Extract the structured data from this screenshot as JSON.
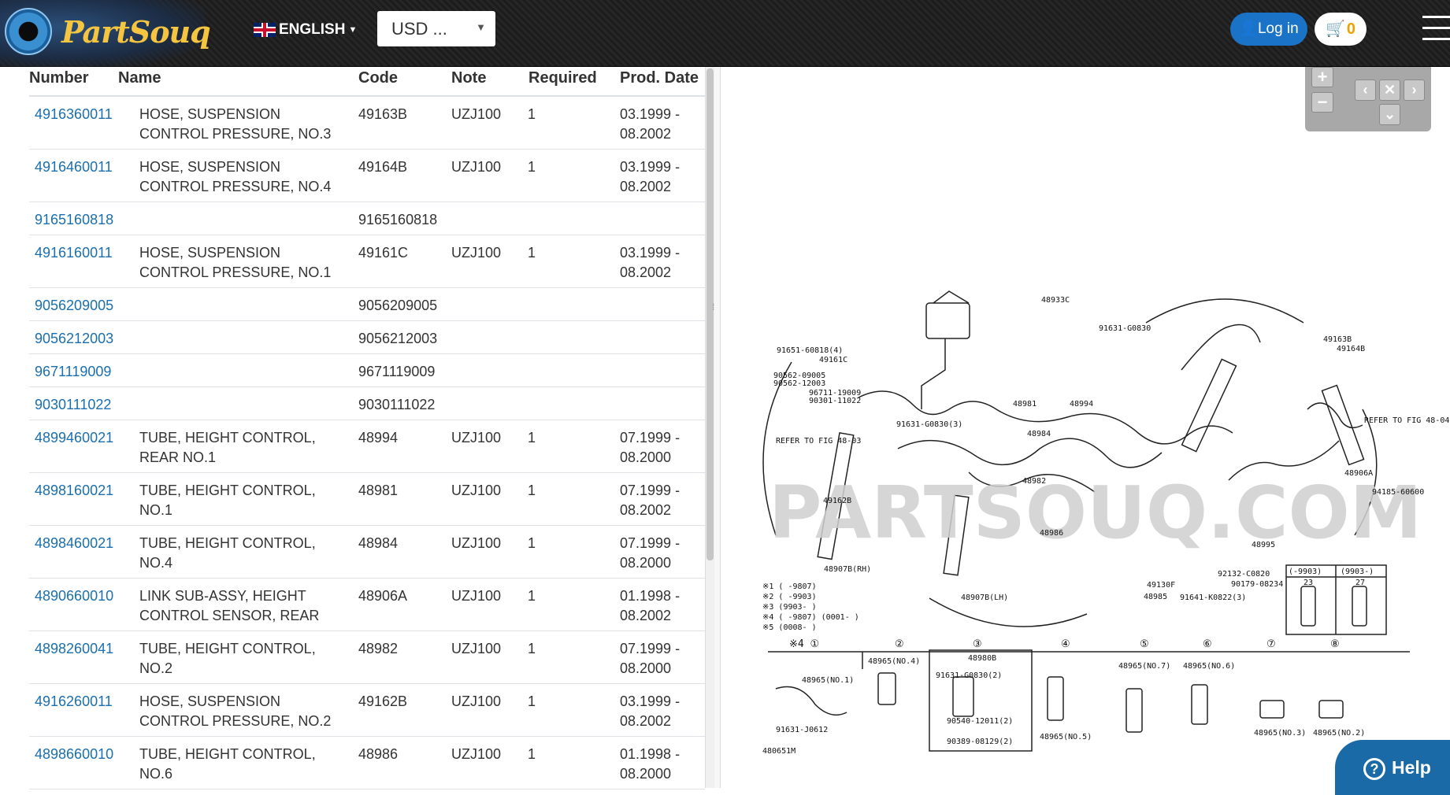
{
  "header": {
    "logo_text": "PartSouq",
    "language": "ENGLISH",
    "currency": "USD ...",
    "login_label": "Log in",
    "cart_count": "0"
  },
  "table": {
    "columns": [
      "Number",
      "Name",
      "Code",
      "Note",
      "Required",
      "Prod. Date"
    ],
    "rows": [
      {
        "number": "4916360011",
        "name": "HOSE, SUSPENSION CONTROL PRESSURE, NO.3",
        "code": "49163B",
        "note": "UZJ100",
        "required": "1",
        "date": "03.1999 - 08.2002"
      },
      {
        "number": "4916460011",
        "name": "HOSE, SUSPENSION CONTROL PRESSURE, NO.4",
        "code": "49164B",
        "note": "UZJ100",
        "required": "1",
        "date": "03.1999 - 08.2002"
      },
      {
        "number": "9165160818",
        "name": "",
        "code": "9165160818",
        "note": "",
        "required": "",
        "date": ""
      },
      {
        "number": "4916160011",
        "name": "HOSE, SUSPENSION CONTROL PRESSURE, NO.1",
        "code": "49161C",
        "note": "UZJ100",
        "required": "1",
        "date": "03.1999 - 08.2002"
      },
      {
        "number": "9056209005",
        "name": "",
        "code": "9056209005",
        "note": "",
        "required": "",
        "date": ""
      },
      {
        "number": "9056212003",
        "name": "",
        "code": "9056212003",
        "note": "",
        "required": "",
        "date": ""
      },
      {
        "number": "9671119009",
        "name": "",
        "code": "9671119009",
        "note": "",
        "required": "",
        "date": ""
      },
      {
        "number": "9030111022",
        "name": "",
        "code": "9030111022",
        "note": "",
        "required": "",
        "date": ""
      },
      {
        "number": "4899460021",
        "name": "TUBE, HEIGHT CONTROL, REAR NO.1",
        "code": "48994",
        "note": "UZJ100",
        "required": "1",
        "date": "07.1999 - 08.2000"
      },
      {
        "number": "4898160021",
        "name": "TUBE, HEIGHT CONTROL, NO.1",
        "code": "48981",
        "note": "UZJ100",
        "required": "1",
        "date": "07.1999 - 08.2002"
      },
      {
        "number": "4898460021",
        "name": "TUBE, HEIGHT CONTROL, NO.4",
        "code": "48984",
        "note": "UZJ100",
        "required": "1",
        "date": "07.1999 - 08.2000"
      },
      {
        "number": "4890660010",
        "name": "LINK SUB-ASSY, HEIGHT CONTROL SENSOR, REAR",
        "code": "48906A",
        "note": "UZJ100",
        "required": "1",
        "date": "01.1998 - 08.2002"
      },
      {
        "number": "4898260041",
        "name": "TUBE, HEIGHT CONTROL, NO.2",
        "code": "48982",
        "note": "UZJ100",
        "required": "1",
        "date": "07.1999 - 08.2000"
      },
      {
        "number": "4916260011",
        "name": "HOSE, SUSPENSION CONTROL PRESSURE, NO.2",
        "code": "49162B",
        "note": "UZJ100",
        "required": "1",
        "date": "03.1999 - 08.2002"
      },
      {
        "number": "4898660010",
        "name": "TUBE, HEIGHT CONTROL, NO.6",
        "code": "48986",
        "note": "UZJ100",
        "required": "1",
        "date": "01.1998 - 08.2000"
      }
    ]
  },
  "diagram": {
    "watermark": "PARTSOUQ.COM",
    "figure_id": "480651M",
    "labels": [
      "48933C",
      "91651-60818(4)",
      "91631-G0830",
      "49163B",
      "49164B",
      "49161C",
      "90562-09005",
      "90562-12003",
      "96711-19009",
      "90301-11022",
      "48981",
      "48994",
      "48984",
      "91631-G0830(3)",
      "REFER TO FIG 48-03",
      "REFER TO FIG 48-04",
      "48982",
      "49162B",
      "48986",
      "48995",
      "48906A",
      "94185-60600",
      "48907B(RH)",
      "48907B(LH)",
      "49130F",
      "48985",
      "91641-K0822(3)",
      "92132-C0820",
      "90179-08234",
      "48965(NO.1)",
      "48965(NO.4)",
      "48980B",
      "91631-G0830(2)",
      "90540-12011(2)",
      "90389-08129(2)",
      "48965(NO.5)",
      "48965(NO.7)",
      "48965(NO.6)",
      "48965(NO.3)",
      "48965(NO.2)",
      "91631-J0612"
    ],
    "footnotes": [
      "※1 ( -9807)",
      "※2 ( -9903)",
      "※3 (9903- )",
      "※4 ( -9807) (0001- )",
      "※5 (0008- )"
    ],
    "inset_headers": [
      "(-9903)",
      "(9903-)"
    ],
    "inset_values": [
      "23",
      "27"
    ],
    "callouts": [
      "※4 ①",
      "②",
      "③",
      "④",
      "⑤",
      "⑥",
      "⑦",
      "⑧"
    ]
  },
  "controls": {
    "zoom_in": "+",
    "zoom_out": "−",
    "nav_left": "‹",
    "nav_close": "✕",
    "nav_right": "›",
    "nav_down": "⌄"
  },
  "help_label": "Help",
  "colors": {
    "link": "#1a6fb0",
    "login_bg": "#1a73c7",
    "help_bg": "#1b6aa8",
    "logo_text": "#f5c542"
  }
}
